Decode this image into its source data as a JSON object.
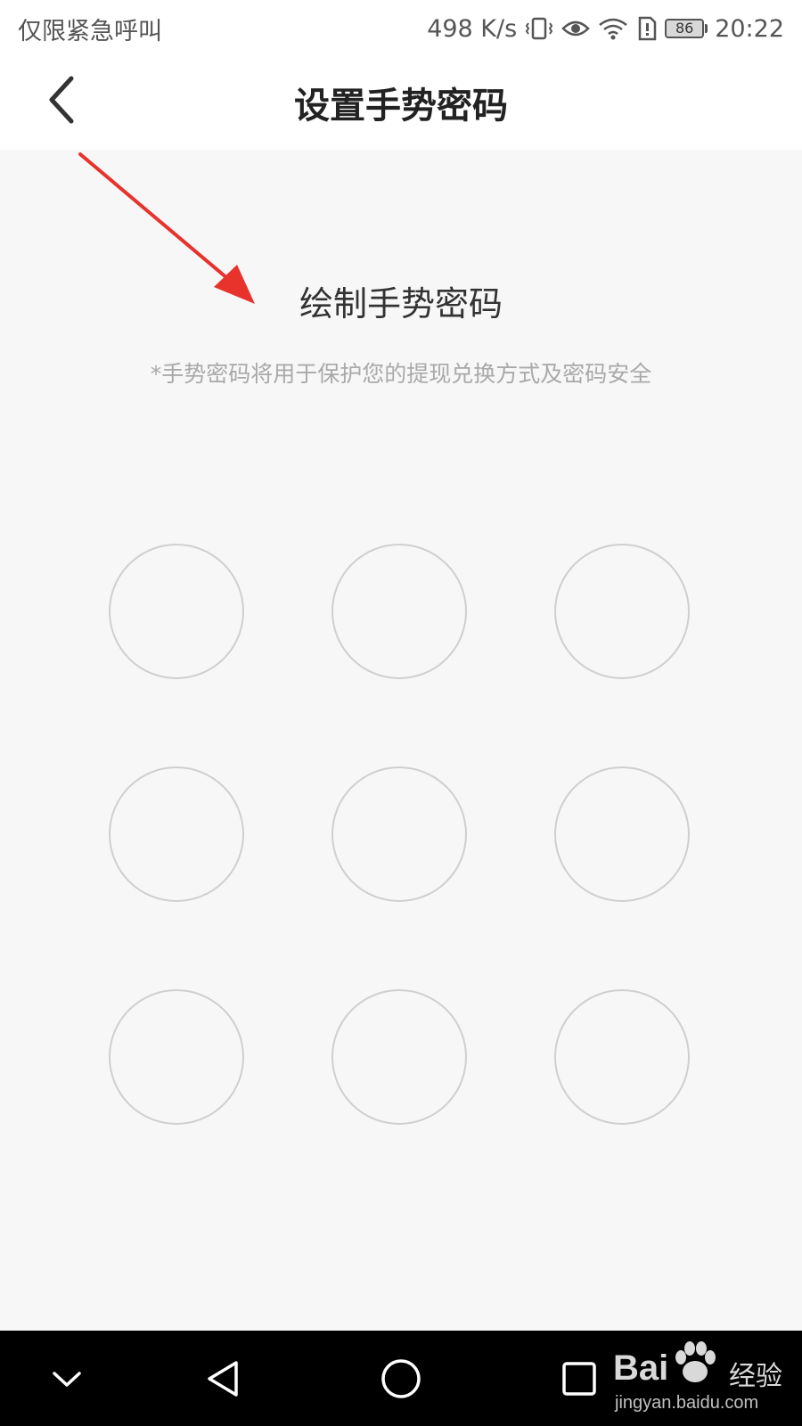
{
  "status_bar": {
    "carrier": "仅限紧急呼叫",
    "net_speed": "498 K/s",
    "battery": "86",
    "time": "20:22",
    "icons": [
      "vibrate-icon",
      "eye-icon",
      "wifi-icon",
      "sim-alert-icon",
      "battery-icon"
    ]
  },
  "header": {
    "title": "设置手势密码",
    "back_icon": "chevron-left-icon"
  },
  "content": {
    "prompt_title": "绘制手势密码",
    "prompt_hint": "*手势密码将用于保护您的提现兑换方式及密码安全"
  },
  "gesture_grid": {
    "rows": 3,
    "cols": 3,
    "dots": [
      1,
      2,
      3,
      4,
      5,
      6,
      7,
      8,
      9
    ]
  },
  "annotation": {
    "arrow_color": "#e8322c"
  },
  "nav_bar": {
    "buttons": [
      "collapse-icon",
      "back-triangle-icon",
      "home-circle-icon",
      "recents-square-icon"
    ]
  },
  "watermark": {
    "brand": "Bai",
    "brand_suffix": "经验",
    "url": "jingyan.baidu.com"
  },
  "colors": {
    "background": "#f7f7f7",
    "dot_border": "#cfcfcf",
    "hint_text": "#a9a9a9",
    "nav_bar": "#000000"
  }
}
